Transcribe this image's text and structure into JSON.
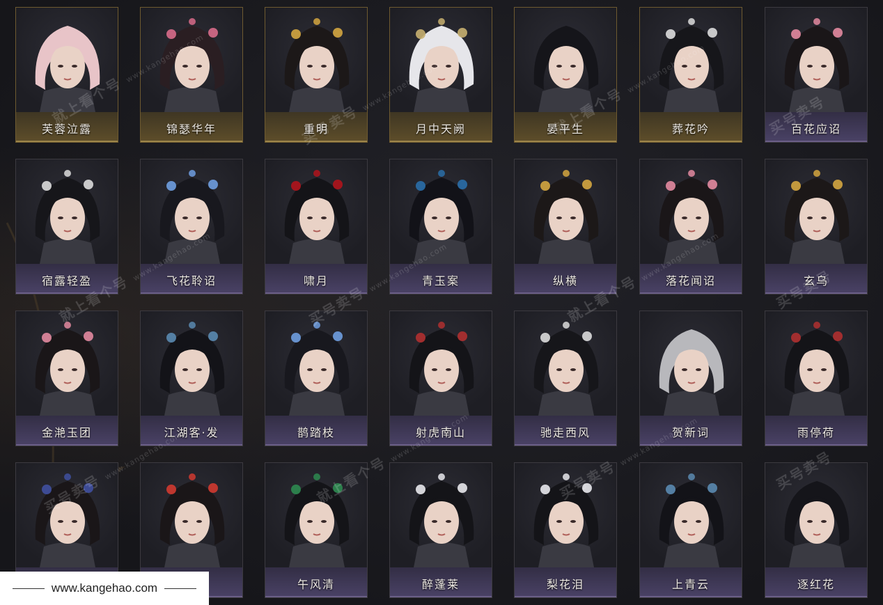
{
  "colors": {
    "background": "#1a1a1d",
    "card_border": "#3c3a40",
    "gold_border": "#6e5a30",
    "name_text": "#ece8e2"
  },
  "cards": [
    {
      "name": "芙蓉泣露",
      "hair": "pink-curly",
      "variant": "gold"
    },
    {
      "name": "锦瑟华年",
      "hair": "dark-ornate",
      "variant": "gold"
    },
    {
      "name": "重明",
      "hair": "golden-crown",
      "variant": "gold"
    },
    {
      "name": "月中天阙",
      "hair": "white-long",
      "variant": "gold"
    },
    {
      "name": "晏平生",
      "hair": "dark-loose",
      "variant": "gold"
    },
    {
      "name": "葬花吟",
      "hair": "dark-bun",
      "variant": "gold"
    },
    {
      "name": "百花应诏",
      "hair": "dark-flowers",
      "variant": "purple"
    },
    {
      "name": "宿露轻盈",
      "hair": "dark-bun",
      "variant": "purple"
    },
    {
      "name": "飞花聆诏",
      "hair": "dark-blue-flowers",
      "variant": "purple"
    },
    {
      "name": "啸月",
      "hair": "dark-rose",
      "variant": "purple"
    },
    {
      "name": "青玉案",
      "hair": "dark-side",
      "variant": "purple"
    },
    {
      "name": "纵横",
      "hair": "golden-crown",
      "variant": "purple"
    },
    {
      "name": "落花闻诏",
      "hair": "dark-flowers",
      "variant": "purple"
    },
    {
      "name": "玄乌",
      "hair": "golden-crown",
      "variant": "purple"
    },
    {
      "name": "金滟玉团",
      "hair": "dark-flowers",
      "variant": "purple"
    },
    {
      "name": "江湖客·发",
      "hair": "dark-ponytail",
      "variant": "purple"
    },
    {
      "name": "鹊踏枝",
      "hair": "dark-blue-flowers",
      "variant": "purple"
    },
    {
      "name": "射虎南山",
      "hair": "dark-headband",
      "variant": "purple"
    },
    {
      "name": "驰走西风",
      "hair": "dark-bun",
      "variant": "purple"
    },
    {
      "name": "贺新词",
      "hair": "gray-veil",
      "variant": "purple"
    },
    {
      "name": "雨停荷",
      "hair": "dark-headband",
      "variant": "purple"
    },
    {
      "name": "",
      "hair": "dark-braid",
      "variant": "purple"
    },
    {
      "name": "",
      "hair": "dark-red-flowers",
      "variant": "purple"
    },
    {
      "name": "午风清",
      "hair": "dark-green-band",
      "variant": "purple"
    },
    {
      "name": "醉蓬莱",
      "hair": "dark-white-flowers",
      "variant": "purple"
    },
    {
      "name": "梨花泪",
      "hair": "dark-white-flowers",
      "variant": "purple"
    },
    {
      "name": "上青云",
      "hair": "dark-ponytail",
      "variant": "purple"
    },
    {
      "name": "逐红花",
      "hair": "dark-loose",
      "variant": "purple"
    }
  ],
  "watermark": {
    "main_1": "买号卖号",
    "main_2": "就上看个号",
    "url": "www.kangehao.com",
    "badge": "看个号"
  },
  "footer": {
    "url": "www.kangehao.com"
  }
}
